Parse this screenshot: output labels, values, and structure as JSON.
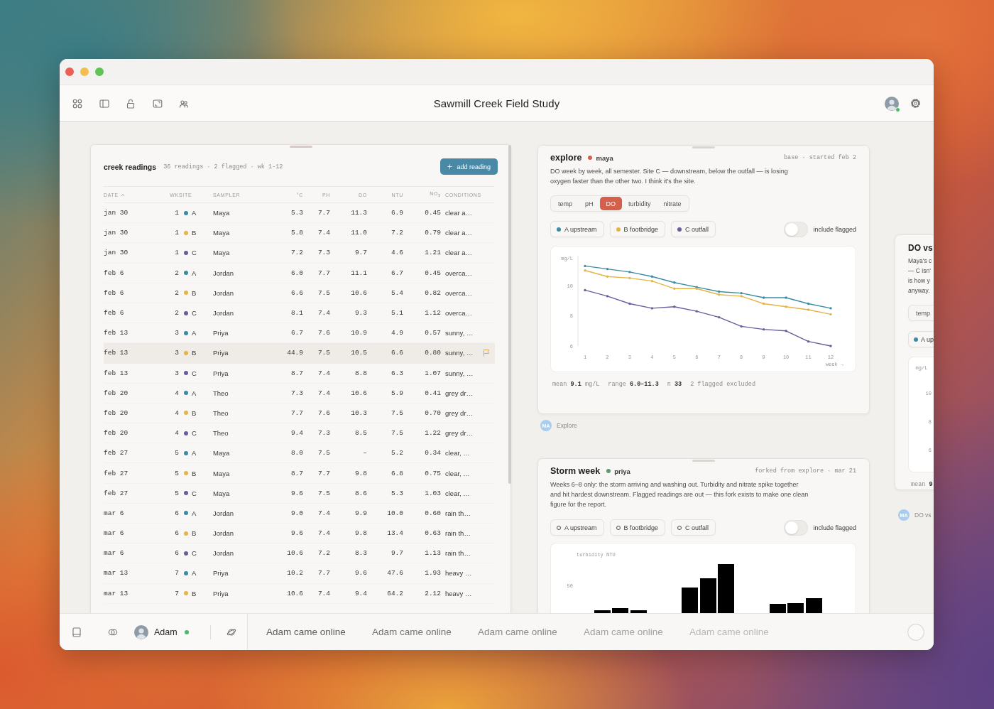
{
  "window": {
    "title": "Sawmill Creek Field Study"
  },
  "toolbar": {
    "user_online": true
  },
  "readings": {
    "title": "creek readings",
    "summary": "36 readings · 2 flagged · wk 1-12",
    "button": "add reading",
    "columns": [
      {
        "label": "DATE",
        "sorted": true
      },
      {
        "label": "WK",
        "sorted": false
      },
      {
        "label": "SITE",
        "sorted": false
      },
      {
        "label": "SAMPLER",
        "sorted": false
      },
      {
        "label": "°C",
        "sorted": false
      },
      {
        "label": "PH",
        "sorted": false
      },
      {
        "label": "DO",
        "sorted": false
      },
      {
        "label": "NTU",
        "sorted": false
      },
      {
        "label": "NO$_{3}$",
        "sorted": false
      },
      {
        "label": "CONDITIONS",
        "sorted": false
      }
    ],
    "rows": [
      {
        "date": "jan 30",
        "wk": "1",
        "site": "A",
        "color": "#3b8ba5",
        "sampler": "Maya",
        "temp": "5.3",
        "ph": "7.7",
        "do": "11.3",
        "ntu": "6.9",
        "no3": "0.45",
        "conditions": "clear a…",
        "flagged": false
      },
      {
        "date": "jan 30",
        "wk": "1",
        "site": "B",
        "color": "#e4b448",
        "sampler": "Maya",
        "temp": "5.8",
        "ph": "7.4",
        "do": "11.0",
        "ntu": "7.2",
        "no3": "0.79",
        "conditions": "clear a…",
        "flagged": false
      },
      {
        "date": "jan 30",
        "wk": "1",
        "site": "C",
        "color": "#6c5c9c",
        "sampler": "Maya",
        "temp": "7.2",
        "ph": "7.3",
        "do": "9.7",
        "ntu": "4.6",
        "no3": "1.21",
        "conditions": "clear a…",
        "flagged": false
      },
      {
        "date": "feb 6",
        "wk": "2",
        "site": "A",
        "color": "#3b8ba5",
        "sampler": "Jordan",
        "temp": "6.0",
        "ph": "7.7",
        "do": "11.1",
        "ntu": "6.7",
        "no3": "0.45",
        "conditions": "overca…",
        "flagged": false
      },
      {
        "date": "feb 6",
        "wk": "2",
        "site": "B",
        "color": "#e4b448",
        "sampler": "Jordan",
        "temp": "6.6",
        "ph": "7.5",
        "do": "10.6",
        "ntu": "5.4",
        "no3": "0.82",
        "conditions": "overca…",
        "flagged": false
      },
      {
        "date": "feb 6",
        "wk": "2",
        "site": "C",
        "color": "#6c5c9c",
        "sampler": "Jordan",
        "temp": "8.1",
        "ph": "7.4",
        "do": "9.3",
        "ntu": "5.1",
        "no3": "1.12",
        "conditions": "overca…",
        "flagged": false
      },
      {
        "date": "feb 13",
        "wk": "3",
        "site": "A",
        "color": "#3b8ba5",
        "sampler": "Priya",
        "temp": "6.7",
        "ph": "7.6",
        "do": "10.9",
        "ntu": "4.9",
        "no3": "0.57",
        "conditions": "sunny, …",
        "flagged": false
      },
      {
        "date": "feb 13",
        "wk": "3",
        "site": "B",
        "color": "#e4b448",
        "sampler": "Priya",
        "temp": "44.9",
        "ph": "7.5",
        "do": "10.5",
        "ntu": "6.6",
        "no3": "0.80",
        "conditions": "sunny, …",
        "flagged": true
      },
      {
        "date": "feb 13",
        "wk": "3",
        "site": "C",
        "color": "#6c5c9c",
        "sampler": "Priya",
        "temp": "8.7",
        "ph": "7.4",
        "do": "8.8",
        "ntu": "6.3",
        "no3": "1.07",
        "conditions": "sunny, …",
        "flagged": false
      },
      {
        "date": "feb 20",
        "wk": "4",
        "site": "A",
        "color": "#3b8ba5",
        "sampler": "Theo",
        "temp": "7.3",
        "ph": "7.4",
        "do": "10.6",
        "ntu": "5.9",
        "no3": "0.41",
        "conditions": "grey dr…",
        "flagged": false
      },
      {
        "date": "feb 20",
        "wk": "4",
        "site": "B",
        "color": "#e4b448",
        "sampler": "Theo",
        "temp": "7.7",
        "ph": "7.6",
        "do": "10.3",
        "ntu": "7.5",
        "no3": "0.70",
        "conditions": "grey dr…",
        "flagged": false
      },
      {
        "date": "feb 20",
        "wk": "4",
        "site": "C",
        "color": "#6c5c9c",
        "sampler": "Theo",
        "temp": "9.4",
        "ph": "7.3",
        "do": "8.5",
        "ntu": "7.5",
        "no3": "1.22",
        "conditions": "grey dr…",
        "flagged": false
      },
      {
        "date": "feb 27",
        "wk": "5",
        "site": "A",
        "color": "#3b8ba5",
        "sampler": "Maya",
        "temp": "8.0",
        "ph": "7.5",
        "do": "–",
        "ntu": "5.2",
        "no3": "0.34",
        "conditions": "clear, …",
        "flagged": false
      },
      {
        "date": "feb 27",
        "wk": "5",
        "site": "B",
        "color": "#e4b448",
        "sampler": "Maya",
        "temp": "8.7",
        "ph": "7.7",
        "do": "9.8",
        "ntu": "6.8",
        "no3": "0.75",
        "conditions": "clear, …",
        "flagged": false
      },
      {
        "date": "feb 27",
        "wk": "5",
        "site": "C",
        "color": "#6c5c9c",
        "sampler": "Maya",
        "temp": "9.6",
        "ph": "7.5",
        "do": "8.6",
        "ntu": "5.3",
        "no3": "1.03",
        "conditions": "clear, …",
        "flagged": false
      },
      {
        "date": "mar 6",
        "wk": "6",
        "site": "A",
        "color": "#3b8ba5",
        "sampler": "Jordan",
        "temp": "9.0",
        "ph": "7.4",
        "do": "9.9",
        "ntu": "10.0",
        "no3": "0.60",
        "conditions": "rain th…",
        "flagged": false
      },
      {
        "date": "mar 6",
        "wk": "6",
        "site": "B",
        "color": "#e4b448",
        "sampler": "Jordan",
        "temp": "9.6",
        "ph": "7.4",
        "do": "9.8",
        "ntu": "13.4",
        "no3": "0.63",
        "conditions": "rain th…",
        "flagged": false
      },
      {
        "date": "mar 6",
        "wk": "6",
        "site": "C",
        "color": "#6c5c9c",
        "sampler": "Jordan",
        "temp": "10.6",
        "ph": "7.2",
        "do": "8.3",
        "ntu": "9.7",
        "no3": "1.13",
        "conditions": "rain th…",
        "flagged": false
      },
      {
        "date": "mar 13",
        "wk": "7",
        "site": "A",
        "color": "#3b8ba5",
        "sampler": "Priya",
        "temp": "10.2",
        "ph": "7.7",
        "do": "9.6",
        "ntu": "47.6",
        "no3": "1.93",
        "conditions": "heavy …",
        "flagged": false
      },
      {
        "date": "mar 13",
        "wk": "7",
        "site": "B",
        "color": "#e4b448",
        "sampler": "Priya",
        "temp": "10.6",
        "ph": "7.4",
        "do": "9.4",
        "ntu": "64.2",
        "no3": "2.12",
        "conditions": "heavy …",
        "flagged": false
      }
    ]
  },
  "notebooks": [
    {
      "kind": "line",
      "title": "explore",
      "author": "maya",
      "color": "#d4604b",
      "meta": "base · started feb 2",
      "description": "DO week by week, all semester. Site C — downstream, below the outfall — is losing oxygen faster than the other two. I think it's the site.",
      "metrics": [
        {
          "label": "temp",
          "selected": false
        },
        {
          "label": "pH",
          "selected": false
        },
        {
          "label": "DO",
          "selected": true
        },
        {
          "label": "turbidity",
          "selected": false
        },
        {
          "label": "nitrate",
          "selected": false
        }
      ],
      "sites": [
        {
          "selected": true
        },
        {
          "selected": true
        },
        {
          "selected": true
        }
      ],
      "flag_toggle": {
        "label": "include flagged",
        "on": false
      },
      "chart_data": {
        "type": "line",
        "ylabel": "mg/L",
        "xlabel": "week →",
        "x": [
          1,
          2,
          3,
          4,
          5,
          6,
          7,
          8,
          9,
          10,
          11,
          12
        ],
        "xlim": [
          1,
          12
        ],
        "ylim": [
          6,
          12
        ],
        "xticks": [
          1,
          2,
          3,
          4,
          5,
          6,
          7,
          8,
          9,
          10,
          11,
          12
        ],
        "yticks": [
          6,
          8,
          10
        ],
        "series": [
          {
            "name": "A upstream",
            "color": "#3b8ba5",
            "values": [
              11.3,
              11.1,
              10.9,
              10.6,
              10.2,
              9.9,
              9.6,
              9.5,
              9.2,
              9.2,
              8.8,
              8.5
            ]
          },
          {
            "name": "B footbridge",
            "color": "#e4b448",
            "values": [
              11.0,
              10.6,
              10.5,
              10.3,
              9.8,
              9.8,
              9.4,
              9.3,
              8.8,
              8.6,
              8.4,
              8.1
            ]
          },
          {
            "name": "C outfall",
            "color": "#6c5c9c",
            "values": [
              9.7,
              9.3,
              8.8,
              8.5,
              8.6,
              8.3,
              7.9,
              7.3,
              7.1,
              7.0,
              6.3,
              6.0
            ]
          }
        ]
      },
      "stats": [
        "mean **9.1** mg/L",
        "range **6.0–11.3**",
        "n **33**",
        "2 flagged excluded"
      ],
      "footer": {
        "initials": "MA",
        "label": "Explore"
      }
    },
    {
      "kind": "bars",
      "title": "Storm week",
      "author": "priya",
      "color": "#5c9c6c",
      "meta": "forked from explore · mar 21",
      "description": "Weeks 6–8 only: the storm arriving and washing out. Turbidity and nitrate spike together and hit hardest downstream. Flagged readings are out — this fork exists to make one clean figure for the report.",
      "sites": [
        {
          "label": "A upstream",
          "selected": false
        },
        {
          "label": "B footbridge",
          "selected": false
        },
        {
          "label": "C outfall",
          "selected": false
        }
      ],
      "flag_toggle": {
        "label": "include flagged",
        "on": false
      },
      "chart": {
        "ylabel": "turbidity NTU",
        "yticks": [
          "50"
        ]
      }
    },
    {
      "kind": "cut",
      "title": "DO vs",
      "description": "Maya's c\n— C isn'\nis how y\nanyway.",
      "metrics": [
        {
          "label": "temp",
          "selected": false
        }
      ],
      "sites": [
        {
          "label": "A up",
          "color": "#3b8ba5",
          "selected": true
        }
      ],
      "chart": {
        "ylabel": "mg/L",
        "yticks": [
          "10",
          "8",
          "6"
        ]
      },
      "stats": [
        "mean **9**"
      ],
      "footer": {
        "initials": "MA",
        "label": "DO vs"
      }
    }
  ],
  "bottom_bar": {
    "user": {
      "name": "Adam",
      "online": true
    },
    "notifications": [
      "Adam came online",
      "Adam came online",
      "Adam came online",
      "Adam came online",
      "Adam came online"
    ]
  }
}
